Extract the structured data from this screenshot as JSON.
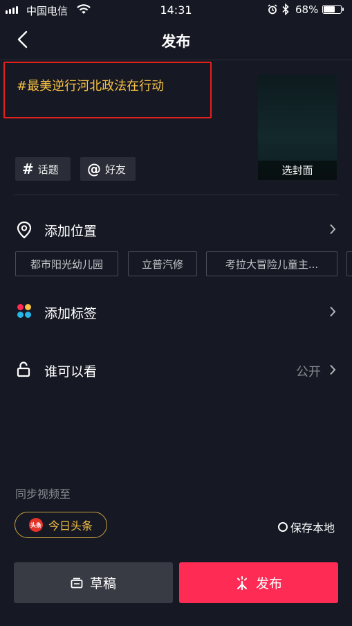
{
  "status_bar": {
    "carrier": "中国电信",
    "time": "14:31",
    "battery_percent": "68%",
    "battery_level": 0.68,
    "icons": [
      "signal-icon",
      "wifi-icon",
      "alarm-icon",
      "bluetooth-icon",
      "battery-icon"
    ]
  },
  "nav": {
    "title": "发布",
    "back_icon": "chevron-left-icon"
  },
  "post": {
    "caption": "#最美逆行河北政法在行动",
    "cover_label": "选封面",
    "topic_symbol": "#",
    "topic_label": "话题",
    "friend_symbol": "@",
    "friend_label": "好友"
  },
  "location": {
    "label": "添加位置",
    "icon": "location-pin-icon",
    "suggestions": [
      "都市阳光幼儿园",
      "立普汽修",
      "考拉大冒险儿童主..."
    ]
  },
  "tags": {
    "label": "添加标签",
    "icon": "colorful-dots-icon"
  },
  "visibility": {
    "label": "谁可以看",
    "value": "公开",
    "icon": "unlock-icon"
  },
  "sync": {
    "label": "同步视频至",
    "toutiao_label": "今日头条",
    "toutiao_logo_text": "头条",
    "save_local_label": "保存本地"
  },
  "actions": {
    "draft_label": "草稿",
    "publish_label": "发布"
  },
  "colors": {
    "background": "#161823",
    "caption": "#f7c245",
    "highlight_border": "#e0221e",
    "publish_button": "#fe2c55",
    "draft_button": "#393b44"
  }
}
